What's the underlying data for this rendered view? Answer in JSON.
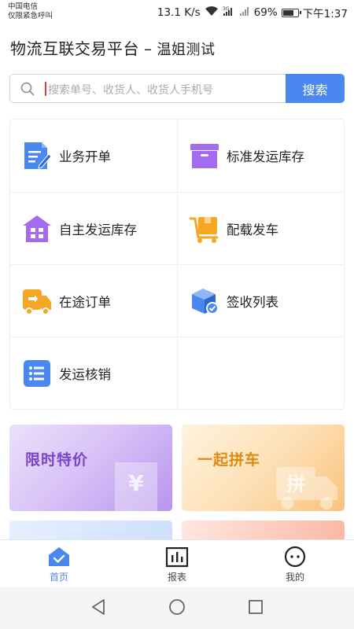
{
  "status_bar": {
    "carrier": "中国电信",
    "carrier_note": "仅限紧急呼叫",
    "speed": "13.1 K/s",
    "battery": "69%",
    "time": "下午1:37"
  },
  "header": {
    "title": "物流互联交易平台",
    "separator": "–",
    "subtitle": "温姐测试"
  },
  "search": {
    "placeholder": "搜索单号、收货人、收货人手机号",
    "button_label": "搜索"
  },
  "menu": {
    "items": [
      {
        "label": "业务开单",
        "icon": "document-edit-icon"
      },
      {
        "label": "标准发运库存",
        "icon": "box-icon"
      },
      {
        "label": "自主发运库存",
        "icon": "warehouse-icon"
      },
      {
        "label": "配载发车",
        "icon": "hand-truck-icon"
      },
      {
        "label": "在途订单",
        "icon": "truck-icon"
      },
      {
        "label": "签收列表",
        "icon": "package-check-icon"
      },
      {
        "label": "发运核销",
        "icon": "list-icon"
      }
    ]
  },
  "promos": {
    "left": {
      "title": "限时特价",
      "deco_text": "¥"
    },
    "right": {
      "title": "一起拼车",
      "deco_text": "拼"
    }
  },
  "tabbar": {
    "tabs": [
      {
        "label": "首页",
        "icon": "home-icon",
        "active": true
      },
      {
        "label": "报表",
        "icon": "report-icon",
        "active": false
      },
      {
        "label": "我的",
        "icon": "profile-icon",
        "active": false
      }
    ]
  },
  "colors": {
    "accent": "#4a87ee",
    "purple": "#a36cf0",
    "orange": "#f5a623"
  }
}
